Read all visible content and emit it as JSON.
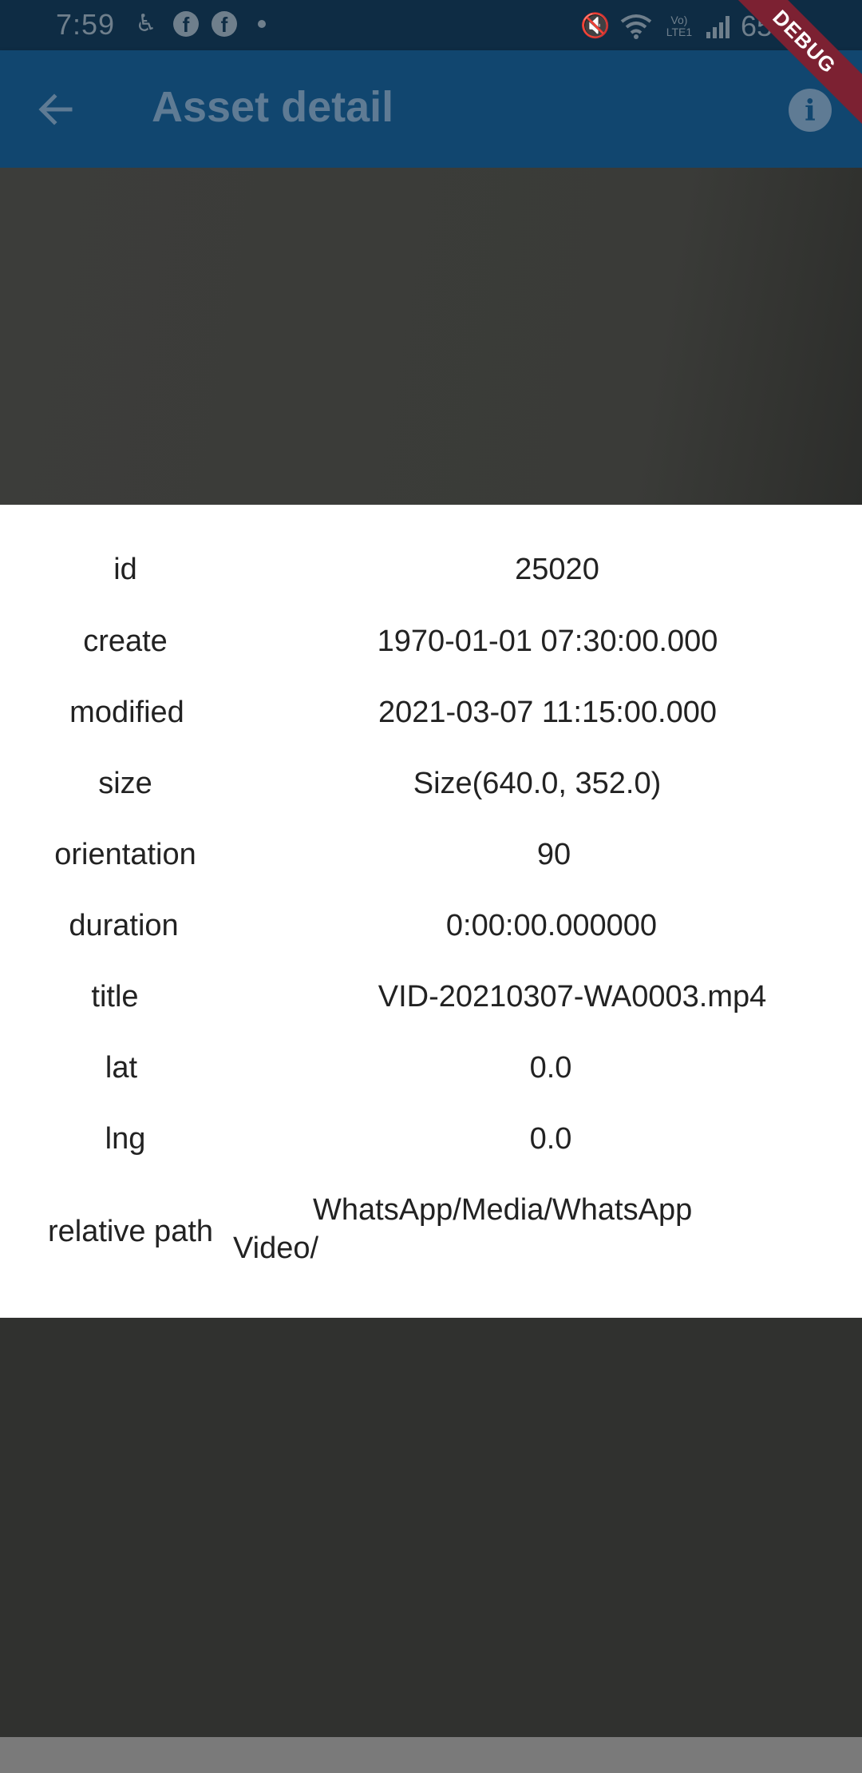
{
  "status_bar": {
    "time": "7:59",
    "battery": "65%",
    "network_label": "Vo) LTE1"
  },
  "app_bar": {
    "title": "Asset detail",
    "debug_banner": "DEBUG"
  },
  "asset_info": [
    {
      "label": "id",
      "value": "25020"
    },
    {
      "label": "create",
      "value": "1970-01-01 07:30:00.000"
    },
    {
      "label": "modified",
      "value": "2021-03-07 11:15:00.000"
    },
    {
      "label": "size",
      "value": "Size(640.0, 352.0)"
    },
    {
      "label": "orientation",
      "value": "90"
    },
    {
      "label": "duration",
      "value": "0:00:00.000000"
    },
    {
      "label": "title",
      "value": "VID-20210307-WA0003.mp4"
    },
    {
      "label": "lat",
      "value": "0.0"
    },
    {
      "label": "lng",
      "value": "0.0"
    },
    {
      "label": "relative path",
      "value_line1": "WhatsApp/Media/WhatsApp",
      "value_line2": "Video/"
    }
  ]
}
